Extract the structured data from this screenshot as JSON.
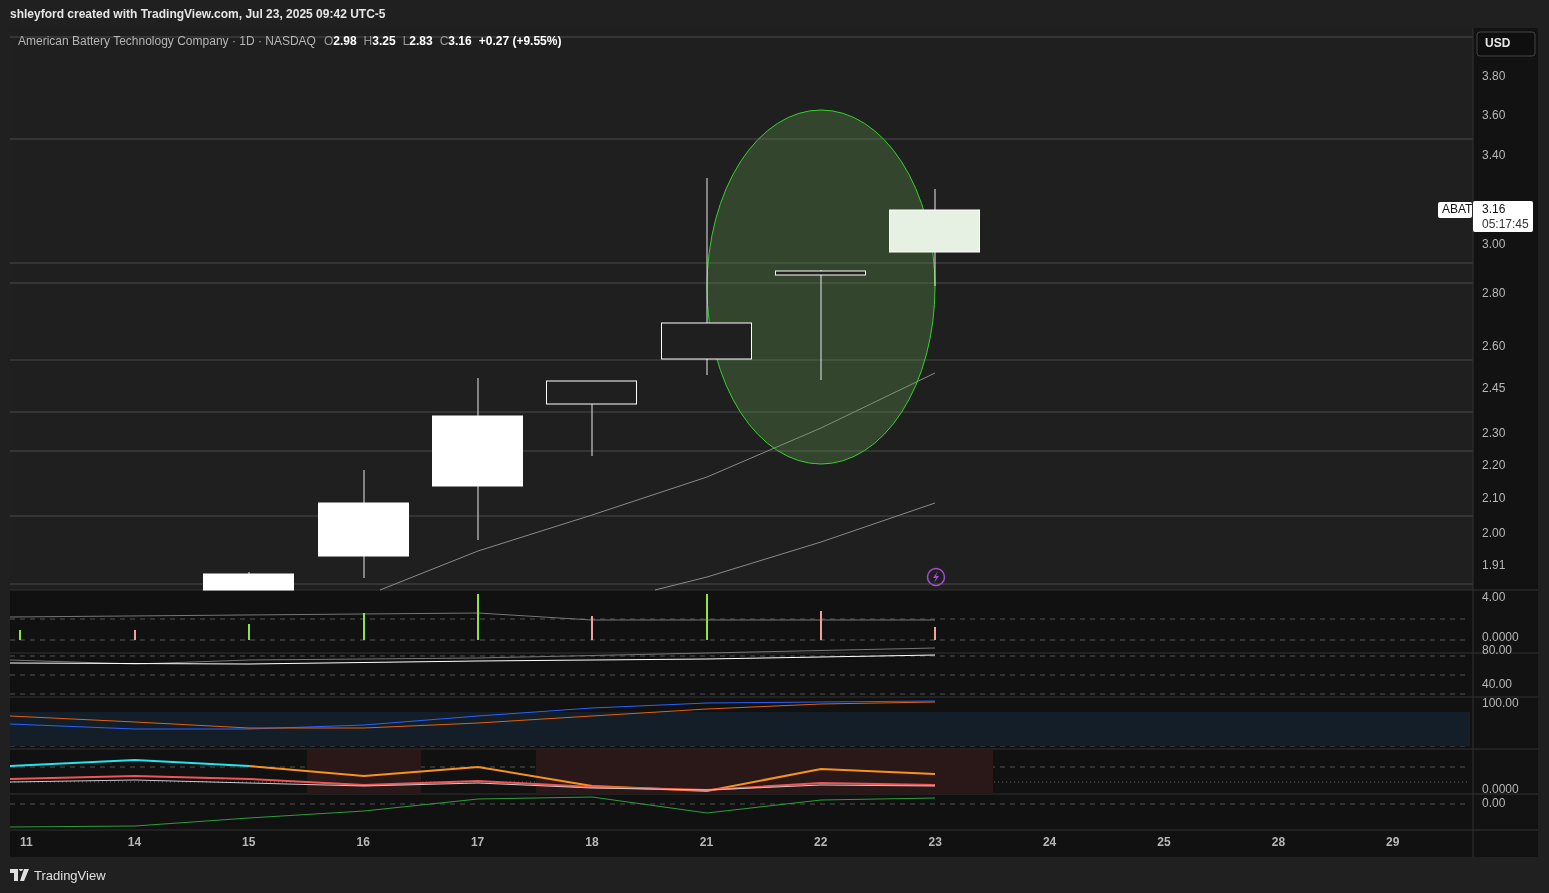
{
  "header": {
    "caption": "shleyford created with TradingView.com, Jul 23, 2025 09:42 UTC-5"
  },
  "legend": {
    "title": "American Battery Technology Company · 1D · NASDAQ",
    "ohlc": [
      {
        "label": "O",
        "value": "2.98"
      },
      {
        "label": "H",
        "value": "3.25"
      },
      {
        "label": "L",
        "value": "2.83"
      },
      {
        "label": "C",
        "value": "3.16"
      }
    ],
    "change": "+0.27 (+9.55%)"
  },
  "currency": "USD",
  "price_axis": [
    "3.80",
    "3.60",
    "3.40",
    "3.00",
    "2.80",
    "2.60",
    "2.45",
    "2.30",
    "2.20",
    "2.10",
    "2.00",
    "1.91"
  ],
  "price_marker": {
    "symbol": "ABAT",
    "price": "3.16",
    "countdown": "05:17:45"
  },
  "panes": [
    {
      "labels": [
        "4.00",
        "0.0000"
      ]
    },
    {
      "labels": [
        "80.00",
        "40.00"
      ]
    },
    {
      "labels": [
        "100.00"
      ]
    },
    {
      "labels": [
        "0.0000"
      ]
    },
    {
      "labels": [
        "0.00"
      ]
    }
  ],
  "time_axis": [
    "11",
    "14",
    "15",
    "16",
    "17",
    "18",
    "21",
    "22",
    "23",
    "24",
    "25",
    "28",
    "29"
  ],
  "footer": {
    "brand": "TradingView"
  }
}
